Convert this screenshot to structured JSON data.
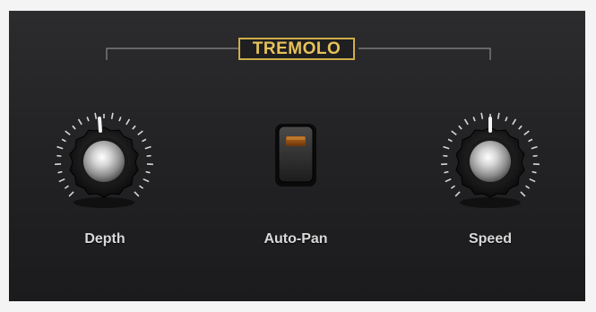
{
  "section": {
    "title": "TREMOLO"
  },
  "controls": {
    "depth": {
      "label": "Depth",
      "icon": "rotary-knob-icon",
      "level": 0.45
    },
    "auto_pan": {
      "label": "Auto-Pan",
      "icon": "toggle-switch-icon",
      "state": "off"
    },
    "speed": {
      "label": "Speed",
      "icon": "rotary-knob-icon",
      "level": 0.5
    }
  },
  "colors": {
    "accent": "#cfae4a",
    "panel": "#252527",
    "label": "#d9d9d9",
    "switch_lamp": "#8a4a12"
  }
}
